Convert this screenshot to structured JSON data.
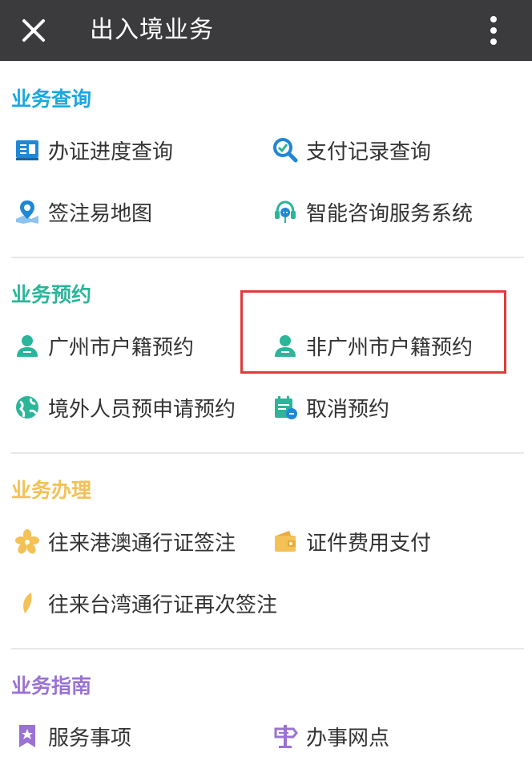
{
  "header": {
    "title": "出入境业务",
    "close_icon": "close-icon",
    "more_icon": "more-vertical-icon"
  },
  "sections": [
    {
      "title": "业务查询",
      "color": "#1aa7e0",
      "items": [
        {
          "label": "办证进度查询",
          "icon": "id-card-icon",
          "color": "#1e88d6"
        },
        {
          "label": "支付记录查询",
          "icon": "magnifier-check-icon",
          "color": "#1e88d6"
        },
        {
          "label": "签注易地图",
          "icon": "map-pin-icon",
          "color": "#1e88d6"
        },
        {
          "label": "智能咨询服务系统",
          "icon": "headset-icon",
          "color": "#2bb59a"
        }
      ]
    },
    {
      "title": "业务预约",
      "color": "#2bb59a",
      "items": [
        {
          "label": "广州市户籍预约",
          "icon": "person-icon",
          "color": "#2bb59a"
        },
        {
          "label": "非广州市户籍预约",
          "icon": "person-icon",
          "color": "#2bb59a"
        },
        {
          "label": "境外人员预申请预约",
          "icon": "globe-icon",
          "color": "#2bb59a"
        },
        {
          "label": "取消预约",
          "icon": "calendar-cancel-icon",
          "color": "#2bb59a"
        }
      ]
    },
    {
      "title": "业务办理",
      "color": "#f3c156",
      "items": [
        {
          "label": "往来港澳通行证签注",
          "icon": "flower-icon",
          "color": "#f3c156"
        },
        {
          "label": "证件费用支付",
          "icon": "wallet-icon",
          "color": "#f3c156"
        },
        {
          "label": "往来台湾通行证再次签注",
          "icon": "leaf-icon",
          "color": "#f3c156"
        }
      ]
    },
    {
      "title": "业务指南",
      "color": "#9a72d4",
      "items": [
        {
          "label": "服务事项",
          "icon": "bookmark-star-icon",
          "color": "#9a72d4"
        },
        {
          "label": "办事网点",
          "icon": "signpost-icon",
          "color": "#9a72d4"
        }
      ]
    }
  ]
}
